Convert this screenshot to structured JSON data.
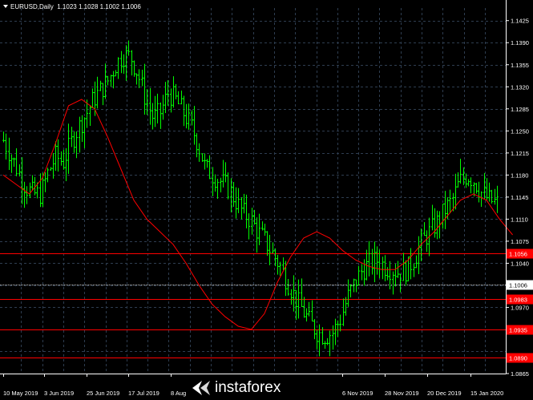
{
  "header": {
    "symbol": "EURUSD,Daily",
    "ohlc": "1.1023 1.1028 1.1002 1.1006"
  },
  "watermark": {
    "text": "instaforex"
  },
  "colors": {
    "background": "#000000",
    "grid": "#2e3d50",
    "candle_up": "#00ff00",
    "ma_line": "#ff0000",
    "level_line": "#ff0000",
    "price_line": "#d0d0d0"
  },
  "chart_data": {
    "type": "line",
    "series": [
      {
        "values": [
          1.1235,
          1.121,
          1.1185,
          1.116,
          1.115,
          1.115,
          1.1185,
          1.121,
          1.12,
          1.123,
          1.1255,
          1.1275,
          1.13,
          1.1315,
          1.133,
          1.1355,
          1.137,
          1.1368,
          1.134,
          1.13,
          1.127,
          1.128,
          1.131,
          1.13,
          1.128,
          1.126,
          1.123,
          1.119,
          1.118,
          1.117,
          1.116,
          1.114,
          1.112,
          1.111,
          1.109,
          1.1075,
          1.1055,
          1.1035,
          1.101,
          1.0985,
          1.0965,
          1.0945,
          1.093,
          1.0925,
          1.093,
          1.095,
          1.0985,
          1.101,
          1.103,
          1.104,
          1.1045,
          1.1035,
          1.103,
          1.1025,
          1.103,
          1.105,
          1.1075,
          1.109,
          1.1105,
          1.1125,
          1.114,
          1.117,
          1.118,
          1.117,
          1.115,
          1.114,
          1.1135
        ]
      }
    ],
    "ma_points": [
      [
        0,
        1.118
      ],
      [
        5,
        1.1165
      ],
      [
        10,
        1.115
      ],
      [
        15,
        1.1175
      ],
      [
        20,
        1.123
      ],
      [
        25,
        1.129
      ],
      [
        30,
        1.13
      ],
      [
        35,
        1.1285
      ],
      [
        40,
        1.124
      ],
      [
        45,
        1.119
      ],
      [
        50,
        1.114
      ],
      [
        55,
        1.111
      ],
      [
        60,
        1.109
      ],
      [
        65,
        1.107
      ],
      [
        70,
        1.104
      ],
      [
        75,
        1.1005
      ],
      [
        80,
        1.0975
      ],
      [
        85,
        1.0955
      ],
      [
        90,
        1.094
      ],
      [
        95,
        1.0935
      ],
      [
        100,
        1.096
      ],
      [
        105,
        1.101
      ],
      [
        110,
        1.105
      ],
      [
        115,
        1.108
      ],
      [
        120,
        1.109
      ],
      [
        125,
        1.108
      ],
      [
        130,
        1.106
      ],
      [
        135,
        1.1045
      ],
      [
        140,
        1.1035
      ],
      [
        145,
        1.103
      ],
      [
        150,
        1.103
      ],
      [
        155,
        1.1045
      ],
      [
        160,
        1.107
      ],
      [
        165,
        1.109
      ],
      [
        170,
        1.1115
      ],
      [
        175,
        1.114
      ],
      [
        180,
        1.115
      ],
      [
        185,
        1.114
      ],
      [
        190,
        1.111
      ],
      [
        195,
        1.1085
      ]
    ],
    "y_ticks": [
      "1.1425",
      "1.1390",
      "1.1355",
      "1.1320",
      "1.1285",
      "1.1250",
      "1.1215",
      "1.1180",
      "1.1145",
      "1.1110",
      "1.1075",
      "1.1040",
      "1.0970",
      "1.0935",
      "1.0865"
    ],
    "x_ticks": [
      "10 May 2019",
      "3 Jun 2019",
      "25 Jun 2019",
      "17 Jul 2019",
      "8 Aug",
      "6 Nov 2019",
      "28 Nov 2019",
      "20 Dec 2019",
      "15 Jan 2020"
    ],
    "ylim": [
      1.0865,
      1.1445
    ],
    "levels": [
      {
        "value": 1.1056,
        "label": "1.1056"
      },
      {
        "value": 1.0983,
        "label": "1.0983"
      },
      {
        "value": 1.0935,
        "label": "1.0935"
      },
      {
        "value": 1.089,
        "label": "1.0890"
      }
    ],
    "current_price": {
      "value": 1.1006,
      "label": "1.1006"
    }
  }
}
